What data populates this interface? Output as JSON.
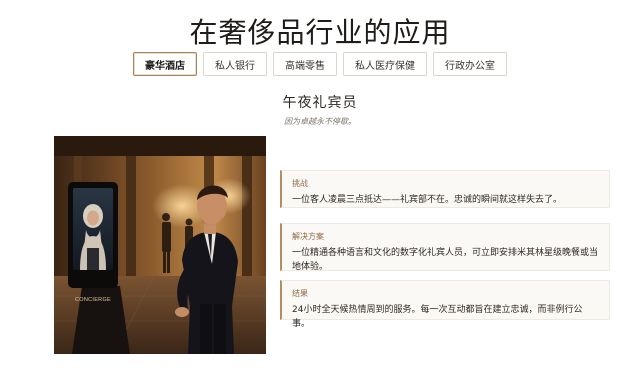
{
  "page": {
    "title": "在奢侈品行业的应用"
  },
  "tabs": [
    {
      "label": "豪华酒店",
      "active": true
    },
    {
      "label": "私人银行",
      "active": false
    },
    {
      "label": "高端零售",
      "active": false
    },
    {
      "label": "私人医疗保健",
      "active": false
    },
    {
      "label": "行政办公室",
      "active": false
    }
  ],
  "section": {
    "title": "午夜礼宾员",
    "tagline": "因为卓越永不停歇。"
  },
  "illustration": {
    "kiosk_text": "CONCIERGE"
  },
  "cards": [
    {
      "label": "挑战",
      "text": "一位客人凌晨三点抵达——礼宾部不在。忠诚的瞬间就这样失去了。"
    },
    {
      "label": "解决方案",
      "text": "一位精通各种语言和文化的数字化礼宾人员，可立即安排米其林星级晚餐或当地体验。"
    },
    {
      "label": "结果",
      "text": "24小时全天候热情周到的服务。每一次互动都旨在建立忠诚，而非例行公事。"
    }
  ],
  "colors": {
    "accent": "#b48d63",
    "card_background": "#fbf9f6",
    "active_tab_border": "#a9825a"
  }
}
